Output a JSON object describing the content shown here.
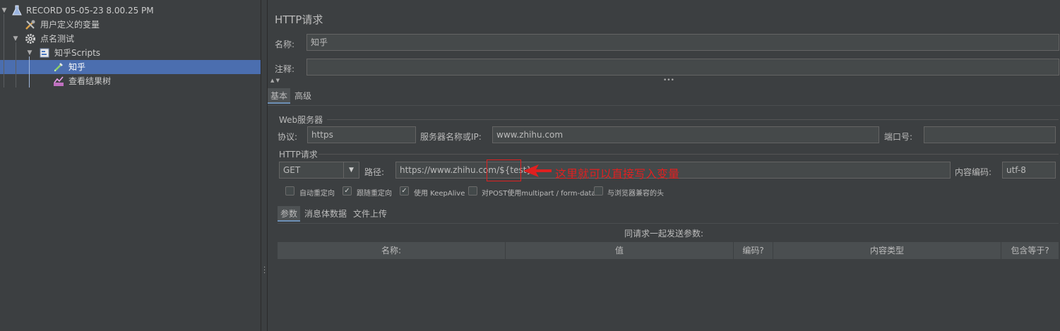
{
  "tree": {
    "items": [
      {
        "label": "RECORD 05-05-23 8.00.25 PM",
        "icon": "flask-icon"
      },
      {
        "label": "用户定义的变量",
        "icon": "tools-icon"
      },
      {
        "label": "点名测试",
        "icon": "gear-icon"
      },
      {
        "label": "知乎Scripts",
        "icon": "script-icon"
      },
      {
        "label": "知乎",
        "icon": "pipette-icon"
      },
      {
        "label": "查看结果树",
        "icon": "chart-icon"
      }
    ]
  },
  "main": {
    "title": "HTTP请求",
    "name_label": "名称:",
    "name_value": "知乎",
    "comment_label": "注释:",
    "comment_value": "",
    "tabs": [
      "基本",
      "高级"
    ],
    "web_server": {
      "group_title": "Web服务器",
      "protocol_label": "协议:",
      "protocol_value": "https",
      "server_label": "服务器名称或IP:",
      "server_value": "www.zhihu.com",
      "port_label": "端口号:",
      "port_value": ""
    },
    "http_request": {
      "group_title": "HTTP请求",
      "method": "GET",
      "path_label": "路径:",
      "path_prefix": "https://www.zhihu.com/",
      "path_var": "${test}",
      "encoding_label": "内容编码:",
      "encoding_value": "utf-8"
    },
    "checkboxes": [
      {
        "label": "自动重定向",
        "checked": false
      },
      {
        "label": "跟随重定向",
        "checked": true
      },
      {
        "label": "使用 KeepAlive",
        "checked": true
      },
      {
        "label": "对POST使用multipart / form-data",
        "checked": false
      },
      {
        "label": "与浏览器兼容的头",
        "checked": false
      }
    ],
    "sub_tabs": [
      "参数",
      "消息体数据",
      "文件上传"
    ],
    "params_caption": "同请求一起发送参数:",
    "table_headers": [
      "名称:",
      "值",
      "编码?",
      "内容类型",
      "包含等于?"
    ],
    "annotation": "这里就可以直接写入变量",
    "colors": {
      "accent": "#4b6eaf",
      "annotation": "#e02020"
    }
  }
}
